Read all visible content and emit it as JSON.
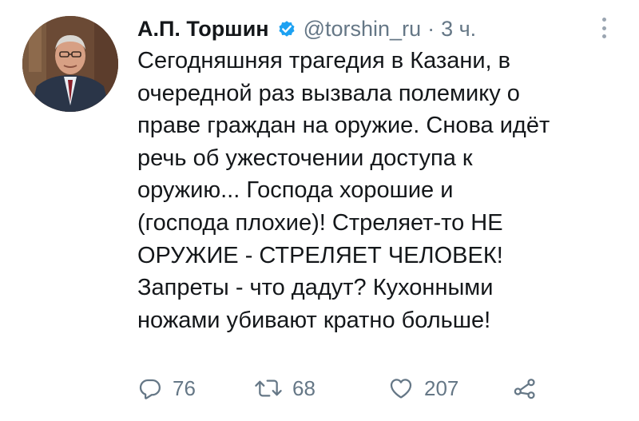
{
  "tweet": {
    "author_name": "А.П. Торшин",
    "handle": "@torshin_ru",
    "separator": "·",
    "time": "3 ч.",
    "lines": [
      "Сегодняшняя трагедия в Казани, в",
      "очередной раз вызвала полемику о",
      "праве граждан на оружие. Снова идёт",
      "речь об ужесточении доступа к",
      "оружию... Господа хорошие и",
      "(господа плохие)! Стреляет-то НЕ",
      "ОРУЖИЕ - СТРЕЛЯЕТ ЧЕЛОВЕК!",
      "Запреты - что дадут? Кухонными",
      "ножами убивают кратно больше!"
    ]
  },
  "actions": {
    "replies": "76",
    "retweets": "68",
    "likes": "207"
  },
  "icons": {
    "verified": "verified-badge-icon",
    "more": "more-vertical-icon",
    "reply": "reply-icon",
    "retweet": "retweet-icon",
    "like": "heart-icon",
    "share": "share-icon"
  },
  "colors": {
    "text": "#14171a",
    "secondary": "#657786",
    "verified": "#1da1f2"
  }
}
